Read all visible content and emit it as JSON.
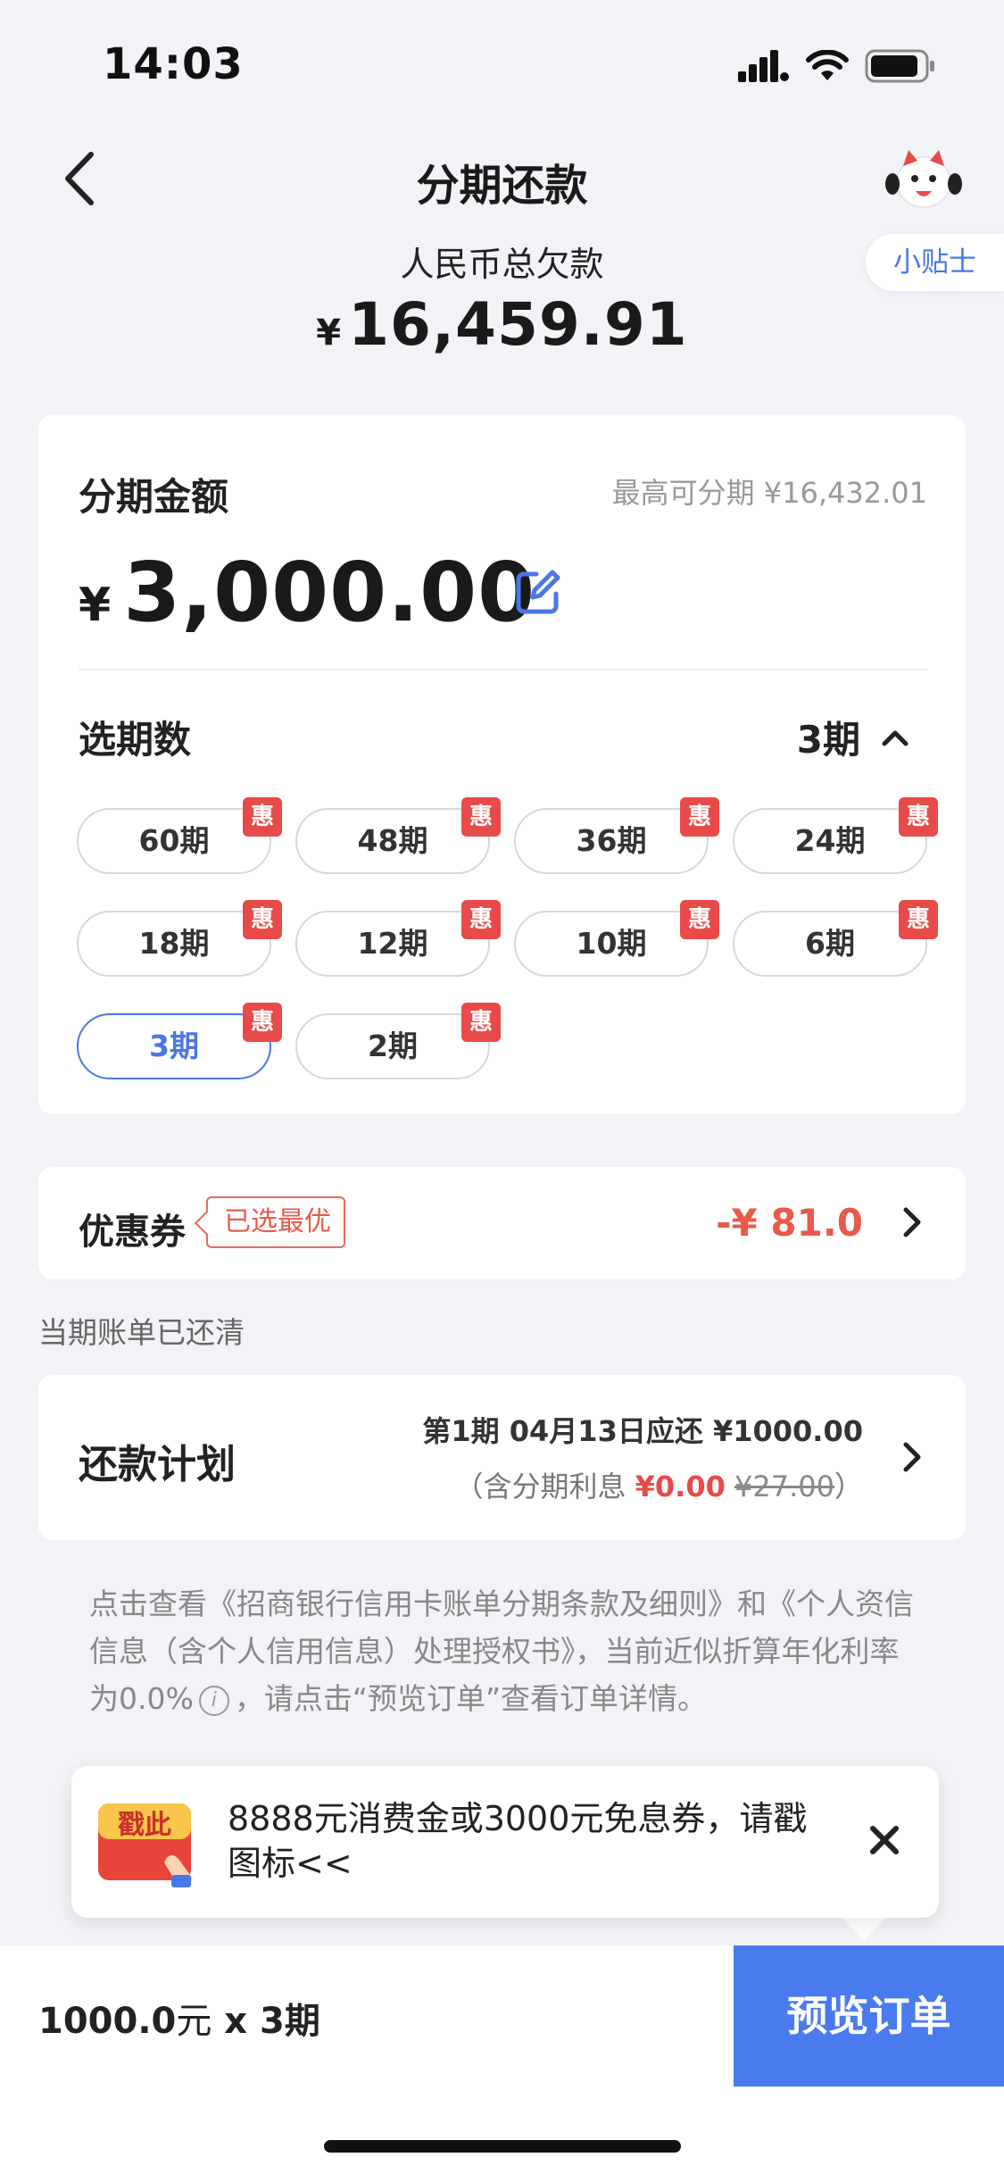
{
  "status_bar": {
    "time": "14:03"
  },
  "nav": {
    "title": "分期还款",
    "tips_label": "小贴士"
  },
  "total": {
    "label": "人民币总欠款",
    "currency": "¥",
    "amount": "16,459.91"
  },
  "installment": {
    "amount_label": "分期金额",
    "max_label": "最高可分期 ¥16,432.01",
    "currency": "¥",
    "amount": "3,000.00",
    "period_label": "选期数",
    "selected_period": "3期",
    "badge": "惠",
    "options": [
      "60期",
      "48期",
      "36期",
      "24期",
      "18期",
      "12期",
      "10期",
      "6期",
      "3期",
      "2期"
    ]
  },
  "coupon": {
    "label": "优惠券",
    "tag": "已选最优",
    "value": "-¥ 81.0"
  },
  "bill_note": "当期账单已还清",
  "plan": {
    "label": "还款计划",
    "line1": "第1期 04月13日应还 ¥1000.00",
    "line2_prefix": "（含分期利息",
    "interest": "¥0.00",
    "original_interest": "¥27.00",
    "line2_suffix": "）"
  },
  "terms": {
    "text_a": "点击查看《招商银行信用卡账单分期条款及细则》和《个人资信信息（含个人信用信息）处理授权书》，当前近似折算年化利率为0.0%",
    "info_symbol": "i",
    "text_b": "，请点击“预览订单”查看订单详情。"
  },
  "promo": {
    "image_text": "戳此",
    "text": "8888元消费金或3000元免息券，请戳图标<<"
  },
  "bottom": {
    "amount": "1000.0",
    "unit": "元",
    "times": "x 3期",
    "button": "预览订单"
  },
  "colors": {
    "accent": "#4a7bee",
    "red": "#e84a4a"
  }
}
